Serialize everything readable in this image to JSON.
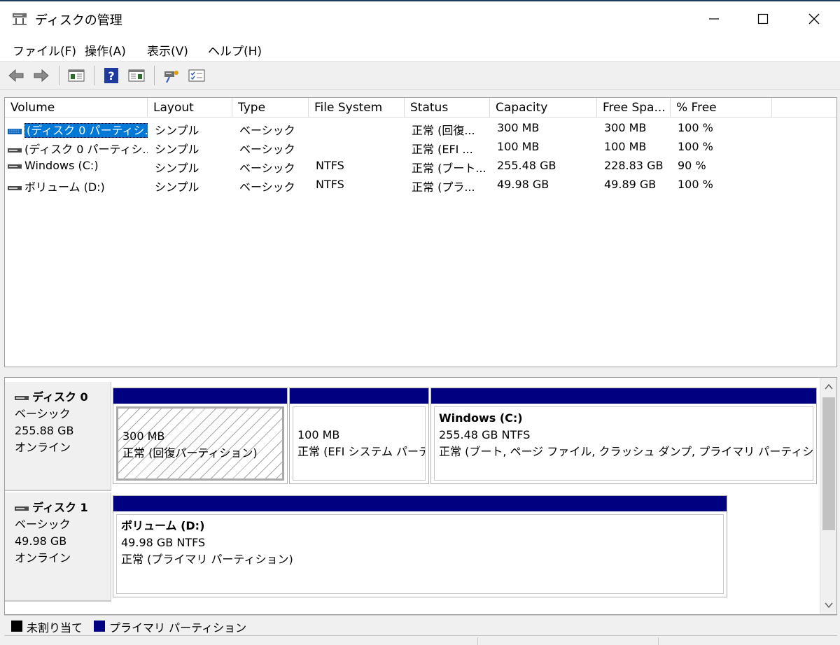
{
  "window": {
    "title": "ディスクの管理",
    "controls": {
      "minimize": "minimize",
      "maximize": "maximize",
      "close": "close"
    }
  },
  "menu": [
    {
      "label": "ファイル(F)"
    },
    {
      "label": "操作(A)"
    },
    {
      "label": "表示(V)"
    },
    {
      "label": "ヘルプ(H)"
    }
  ],
  "toolbar": [
    "back-icon",
    "forward-icon",
    "console-tree-icon",
    "help-icon",
    "action-pane-icon",
    "connect-icon",
    "properties-icon"
  ],
  "volume_list": {
    "columns": [
      "Volume",
      "Layout",
      "Type",
      "File System",
      "Status",
      "Capacity",
      "Free Spa...",
      "% Free"
    ],
    "rows": [
      {
        "volume": "(ディスク 0 パーティシ...",
        "layout": "シンプル",
        "type": "ベーシック",
        "fs": "",
        "status": "正常 (回復...",
        "capacity": "300 MB",
        "free": "300 MB",
        "pct": "100 %",
        "selected": true
      },
      {
        "volume": "(ディスク 0 パーティシ...",
        "layout": "シンプル",
        "type": "ベーシック",
        "fs": "",
        "status": "正常 (EFI ...",
        "capacity": "100 MB",
        "free": "100 MB",
        "pct": "100 %"
      },
      {
        "volume": "Windows (C:)",
        "layout": "シンプル",
        "type": "ベーシック",
        "fs": "NTFS",
        "status": "正常 (ブート...",
        "capacity": "255.48 GB",
        "free": "228.83 GB",
        "pct": "90 %"
      },
      {
        "volume": "ボリューム (D:)",
        "layout": "シンプル",
        "type": "ベーシック",
        "fs": "NTFS",
        "status": "正常 (プラ...",
        "capacity": "49.98 GB",
        "free": "49.89 GB",
        "pct": "100 %"
      }
    ]
  },
  "disks": [
    {
      "name": "ディスク 0",
      "type": "ベーシック",
      "size": "255.88 GB",
      "state": "オンライン",
      "partitions": [
        {
          "name": "",
          "size": "300 MB",
          "status": "正常 (回復パーティション)"
        },
        {
          "name": "",
          "size": "100 MB",
          "status": "正常 (EFI システム パーティション)"
        },
        {
          "name": "Windows  (C:)",
          "size": "255.48 GB NTFS",
          "status": "正常 (ブート, ページ ファイル, クラッシュ ダンプ, プライマリ パーティション)"
        }
      ]
    },
    {
      "name": "ディスク 1",
      "type": "ベーシック",
      "size": "49.98 GB",
      "state": "オンライン",
      "partitions": [
        {
          "name": "ボリューム  (D:)",
          "size": "49.98 GB NTFS",
          "status": "正常 (プライマリ パーティション)"
        }
      ]
    }
  ],
  "legend": [
    {
      "label": "未割り当て",
      "color": "#000000"
    },
    {
      "label": "プライマリ パーティション",
      "color": "#000080"
    }
  ]
}
